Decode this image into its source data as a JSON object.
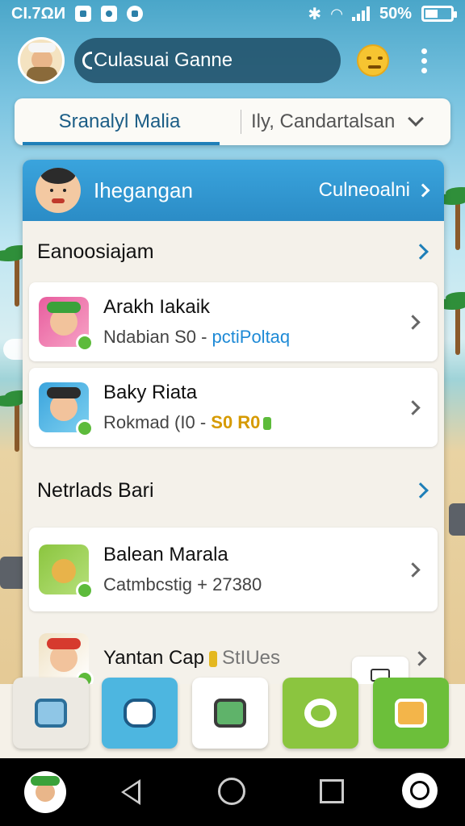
{
  "status_bar": {
    "time": "CI.7ΩИ",
    "battery": "50%",
    "battery_level": 0.5
  },
  "app_bar": {
    "search_text": "Culasuai Ganne"
  },
  "tabs": {
    "active": "Sranalyl Malia",
    "other": "Ily, Candartalsan"
  },
  "panel": {
    "header_title": "Ihegangan",
    "header_link": "Culneoalni",
    "sections": [
      {
        "title": "Eanoosiajam",
        "items": [
          {
            "title": "Arakh Iakaik",
            "sub": "Ndabian S0 - ",
            "sub_accent": "pctiPoltaq"
          },
          {
            "title": "Baky Riata",
            "sub": "Rokmad (I0 - ",
            "sub_accent": "S0 R0"
          }
        ]
      },
      {
        "title": "Netrlads Bari",
        "items": [
          {
            "title": "Balean Marala",
            "sub": "Catmbcstig + 27380",
            "sub_accent": ""
          }
        ]
      }
    ],
    "last_item": {
      "title": "Yantan Cap",
      "tag_text": "StIUes"
    }
  },
  "colors": {
    "accent": "#2b8cc6",
    "header_blue": "#3aa4dd",
    "dock_blue": "#4db6e0",
    "dock_green": "#8bc53f",
    "status_green": "#5dbb3b"
  },
  "icons": {
    "dock": [
      "box-icon",
      "camera-icon",
      "clipboard-check-icon",
      "settings-gear-icon",
      "profile-icon"
    ]
  }
}
